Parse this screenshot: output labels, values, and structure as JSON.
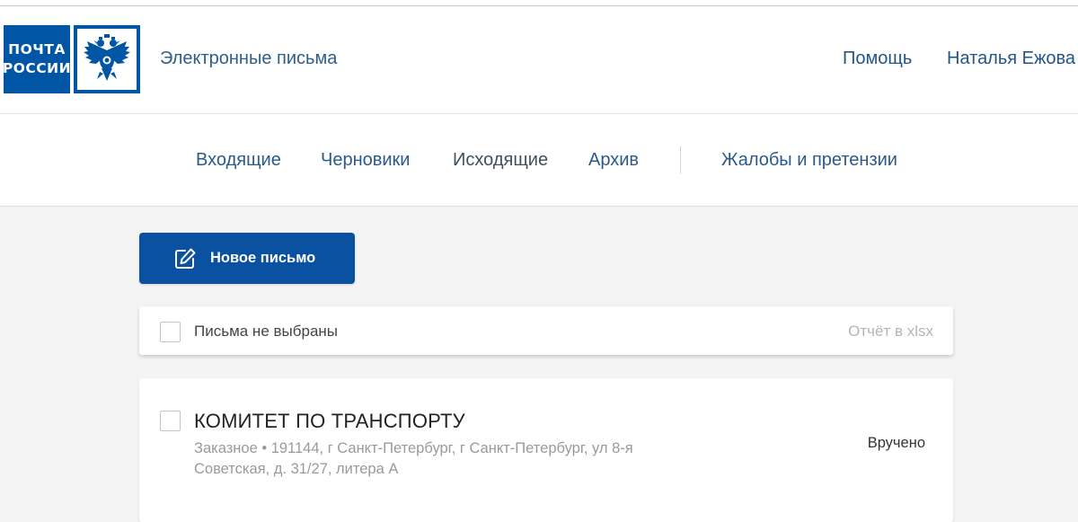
{
  "brand": {
    "logo_line1": "ПОЧТА",
    "logo_line2": "РОССИИ",
    "emblem_icon": "double-headed-eagle-icon",
    "brand_color": "#0055a5"
  },
  "header": {
    "service_title": "Электронные письма",
    "help_label": "Помощь",
    "user_name": "Наталья Ежова"
  },
  "nav": {
    "items": [
      {
        "label": "Входящие"
      },
      {
        "label": "Черновики"
      },
      {
        "label": "Исходящие",
        "active": true
      },
      {
        "label": "Архив"
      },
      {
        "label": "Жалобы и претензии"
      }
    ]
  },
  "actions": {
    "new_letter_label": "Новое письмо",
    "new_letter_icon": "edit-icon"
  },
  "toolbar": {
    "selection_status": "Письма не выбраны",
    "report_label": "Отчёт в xlsx"
  },
  "letters": [
    {
      "recipient": "КОМИТЕТ ПО ТРАНСПОРТУ",
      "details": "Заказное • 191144, г Санкт-Петербург, г Санкт-Петербург, ул 8-я Советская, д. 31/27, литера А",
      "status": "Вручено"
    }
  ],
  "colors": {
    "accent": "#0b51a1",
    "link": "#24558a",
    "background": "#f4f4f4"
  }
}
